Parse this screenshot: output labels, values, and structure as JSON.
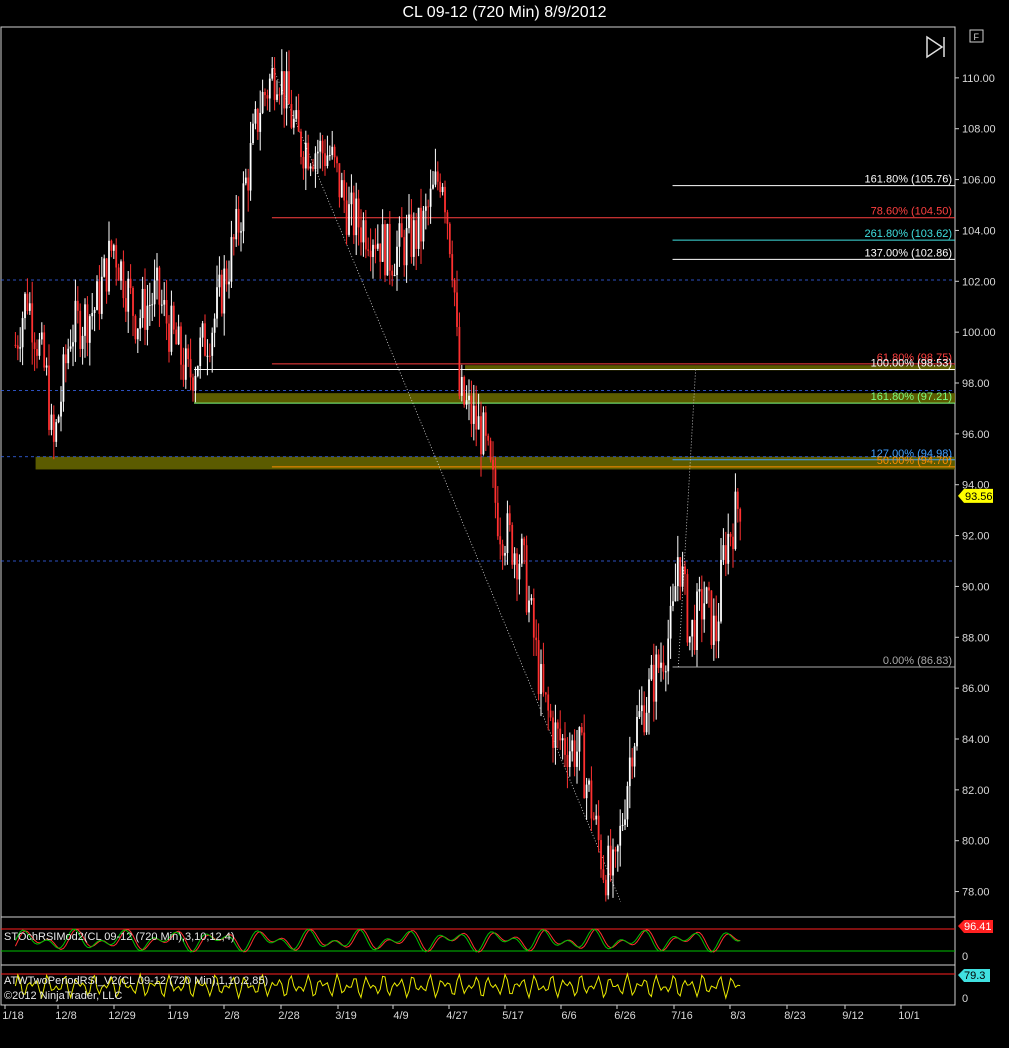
{
  "window": {
    "title": "CL 09-12 (720 Min)  8/9/2012"
  },
  "toolbar": {
    "f_label": "F",
    "play_icon": "skip-forward-icon"
  },
  "chart_data": {
    "type": "candlestick",
    "instrument": "CL 09-12",
    "interval": "720 Min",
    "price_axis": {
      "min": 77,
      "max": 112,
      "ticks": [
        78,
        80,
        82,
        84,
        86,
        88,
        90,
        92,
        94,
        96,
        98,
        100,
        102,
        104,
        106,
        108,
        110
      ]
    },
    "x_ticks": [
      "1/18",
      "12/8",
      "12/29",
      "1/19",
      "2/8",
      "2/28",
      "3/19",
      "4/9",
      "4/27",
      "5/17",
      "6/6",
      "6/26",
      "7/16",
      "8/3",
      "8/23",
      "9/12",
      "10/1"
    ],
    "last_price": 93.56,
    "last_price_label": "93.56",
    "path_points": [
      {
        "x": "12/1",
        "price": 99.5
      },
      {
        "x": "12/5",
        "price": 101.5
      },
      {
        "x": "12/12",
        "price": 98
      },
      {
        "x": "12/14",
        "price": 95.2
      },
      {
        "x": "12/20",
        "price": 100
      },
      {
        "x": "12/29",
        "price": 101
      },
      {
        "x": "1/4",
        "price": 103.5
      },
      {
        "x": "1/12",
        "price": 100.5
      },
      {
        "x": "1/19",
        "price": 101.5
      },
      {
        "x": "1/30",
        "price": 98.2
      },
      {
        "x": "2/8",
        "price": 100.5
      },
      {
        "x": "2/16",
        "price": 104
      },
      {
        "x": "2/24",
        "price": 109
      },
      {
        "x": "3/1",
        "price": 110.5
      },
      {
        "x": "3/8",
        "price": 107.5
      },
      {
        "x": "3/19",
        "price": 107
      },
      {
        "x": "3/26",
        "price": 104.5
      },
      {
        "x": "4/3",
        "price": 104
      },
      {
        "x": "4/9",
        "price": 103
      },
      {
        "x": "4/20",
        "price": 104
      },
      {
        "x": "4/27",
        "price": 106.5
      },
      {
        "x": "5/1",
        "price": 102.5
      },
      {
        "x": "5/3",
        "price": 97.5
      },
      {
        "x": "5/11",
        "price": 96
      },
      {
        "x": "5/17",
        "price": 92.5
      },
      {
        "x": "5/25",
        "price": 91
      },
      {
        "x": "6/1",
        "price": 85.5
      },
      {
        "x": "6/6",
        "price": 84
      },
      {
        "x": "6/14",
        "price": 83.5
      },
      {
        "x": "6/22",
        "price": 79
      },
      {
        "x": "6/26",
        "price": 78.5
      },
      {
        "x": "7/2",
        "price": 84
      },
      {
        "x": "7/10",
        "price": 86.5
      },
      {
        "x": "7/16",
        "price": 88.5
      },
      {
        "x": "7/18",
        "price": 91.5
      },
      {
        "x": "7/22",
        "price": 88
      },
      {
        "x": "7/27",
        "price": 89.5
      },
      {
        "x": "7/31",
        "price": 88
      },
      {
        "x": "8/3",
        "price": 91.5
      },
      {
        "x": "8/9",
        "price": 93.6
      }
    ],
    "fib_levels": [
      {
        "label": "161.80% (105.76)",
        "price": 105.76,
        "color": "#ffffff"
      },
      {
        "label": "78.60% (104.50)",
        "price": 104.5,
        "color": "#ff4040"
      },
      {
        "label": "261.80% (103.62)",
        "price": 103.62,
        "color": "#40e0e0"
      },
      {
        "label": "137.00% (102.86)",
        "price": 102.86,
        "color": "#ffffff"
      },
      {
        "label": "61.80% (98.75)",
        "price": 98.75,
        "color": "#ff4040"
      },
      {
        "label": "100.00% (98.53)",
        "price": 98.53,
        "color": "#ffffff"
      },
      {
        "label": "161.80% (97.21)",
        "price": 97.21,
        "color": "#7fff7f"
      },
      {
        "label": "127.00% (94.98)",
        "price": 94.98,
        "color": "#40a0ff"
      },
      {
        "label": "50.00% (94.70)",
        "price": 94.7,
        "color": "#ff8c00"
      },
      {
        "label": "0.00% (86.83)",
        "price": 86.83,
        "color": "#aaaaaa"
      }
    ],
    "horizontal_lines": [
      {
        "price": 102.05
      },
      {
        "price": 97.7
      },
      {
        "price": 95.1
      },
      {
        "price": 91.0
      }
    ],
    "zones": [
      {
        "from_x": "12/8",
        "to_x": "8/9",
        "top": 95.1,
        "bottom": 94.6
      },
      {
        "from_x": "2/1",
        "to_x": "8/9",
        "top": 97.6,
        "bottom": 97.2
      },
      {
        "from_x": "5/5",
        "to_x": "8/9",
        "top": 98.7,
        "bottom": 98.5
      }
    ],
    "indicators": [
      {
        "name": "STOchRSIMod2(CL 09-12 (720 Min),3,10,12,4)",
        "last_value_label": "96.41",
        "zero_label": "0"
      },
      {
        "name": "ATWTwoPeriodRSI_V2(CL 09-12 (720 Min),1,10,2,85)",
        "last_value_label": "79.3",
        "zero_label": "0"
      }
    ],
    "copyright": "©2012 NinjaTrader, LLC"
  },
  "colors": {
    "up_candle": "#ffffff",
    "down_candle": "#ff3030",
    "last_price_bg": "#ffff00",
    "stoch_green": "#00c000",
    "stoch_red": "#ff3030",
    "rsi_yellow": "#e8e800",
    "rsi_cyan": "#40e0e0",
    "zone": "#6b6b00"
  }
}
